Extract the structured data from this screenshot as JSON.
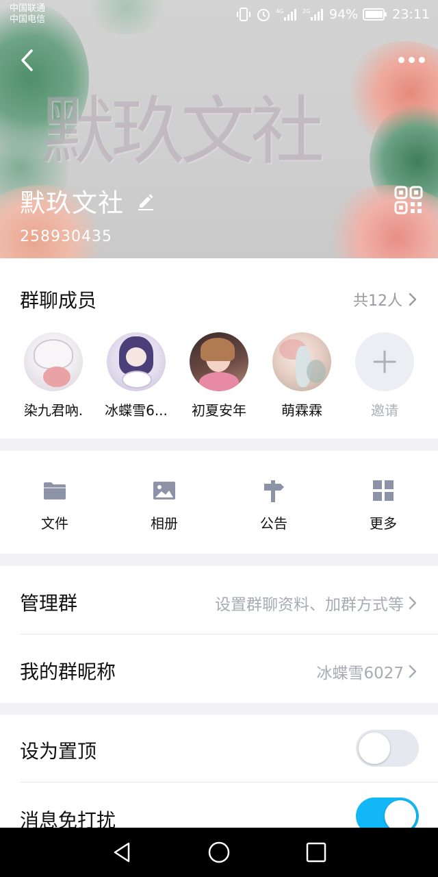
{
  "status_bar": {
    "carrier_1": "中国联通",
    "carrier_2": "中国电信",
    "battery": "94%",
    "time": "23:11",
    "network_1": "4G",
    "network_2": "2G"
  },
  "header": {
    "banner_art": "默玖文社",
    "group_name": "默玖文社",
    "group_id": "258930435"
  },
  "members": {
    "title": "群聊成员",
    "count": "共12人",
    "items": [
      {
        "name": "染九君吶.",
        "avatar": "anime-girl-white-hair"
      },
      {
        "name": "冰蝶雪6...",
        "avatar": "anime-girl-purple-hair"
      },
      {
        "name": "初夏安年",
        "avatar": "girl-photo"
      },
      {
        "name": "萌霖霖",
        "avatar": "anime-illustration"
      }
    ],
    "invite_label": "邀请"
  },
  "actions": [
    {
      "label": "文件",
      "icon": "folder-icon"
    },
    {
      "label": "相册",
      "icon": "image-icon"
    },
    {
      "label": "公告",
      "icon": "signpost-icon"
    },
    {
      "label": "更多",
      "icon": "grid-icon"
    }
  ],
  "settings": {
    "manage_group": {
      "label": "管理群",
      "value": "设置群聊资料、加群方式等"
    },
    "my_nickname": {
      "label": "我的群昵称",
      "value": "冰蝶雪6027"
    },
    "pin_top": {
      "label": "设为置顶",
      "on": false
    },
    "do_not_disturb": {
      "label": "消息免打扰",
      "on": true
    }
  },
  "colors": {
    "accent": "#12b7f5",
    "secondary_text": "#a9abb3",
    "divider_bg": "#f2f2f6",
    "action_icon": "#8c93a6"
  }
}
